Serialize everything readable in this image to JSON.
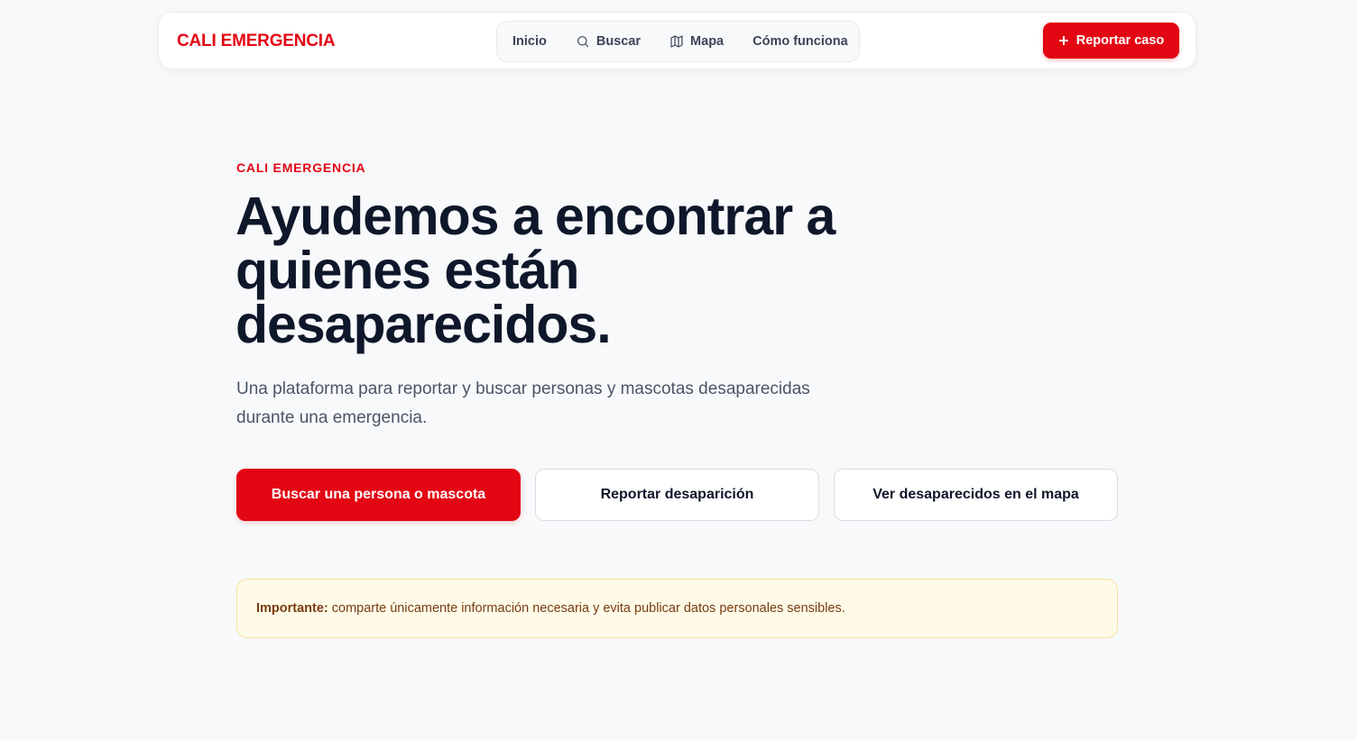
{
  "header": {
    "brand": "CALI EMERGENCIA",
    "nav": [
      {
        "label": "Inicio",
        "icon": ""
      },
      {
        "label": "Buscar",
        "icon": "search-icon"
      },
      {
        "label": "Mapa",
        "icon": "map-icon"
      },
      {
        "label": "Cómo funciona",
        "icon": ""
      }
    ],
    "report_button": {
      "label": "Reportar caso",
      "icon": "plus-icon"
    }
  },
  "hero": {
    "eyebrow": "CALI EMERGENCIA",
    "title": "Ayudemos a encontrar a quienes están desaparecidos.",
    "subtitle": "Una plataforma para reportar y buscar personas y mascotas desaparecidas durante una emergencia.",
    "buttons": {
      "search": "Buscar una persona o mascota",
      "report": "Reportar desaparición",
      "map": "Ver desaparecidos en el mapa"
    }
  },
  "notice": {
    "label": "Importante:",
    "text": "comparte únicamente información necesaria y evita publicar datos personales sensibles."
  },
  "colors": {
    "accent": "#e30613",
    "background": "#f8f9fb",
    "text": "#0f172a",
    "muted_text": "#4b5566",
    "notice_background": "#fffbe8",
    "notice_border": "#f6e3a1",
    "notice_text": "#7a3b0f"
  }
}
